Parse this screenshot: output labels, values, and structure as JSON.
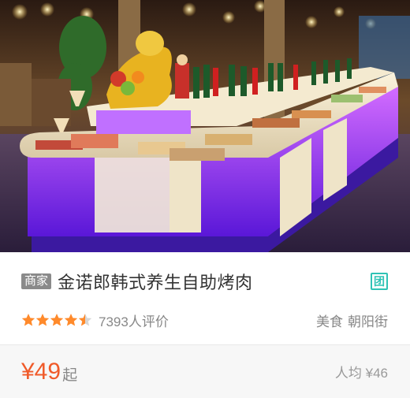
{
  "listing": {
    "merchant_tag": "商家",
    "shop_name": "金诺郎韩式养生自助烤肉",
    "group_buy_icon": "团",
    "rating_stars": 4.5,
    "rating_max": 5,
    "review_count": "7393人评价",
    "category": "美食",
    "district": "朝阳街",
    "price": "¥49",
    "price_suffix": "起",
    "avg_price": "人均 ¥46"
  },
  "colors": {
    "price": "#f05a29",
    "star_on": "#ff8a2b",
    "star_off": "#d6d6d6",
    "tuan": "#2fc3b5"
  },
  "icons": {
    "photo": "buffet-photo",
    "tuan": "group-buy-icon",
    "star": "star-icon"
  }
}
